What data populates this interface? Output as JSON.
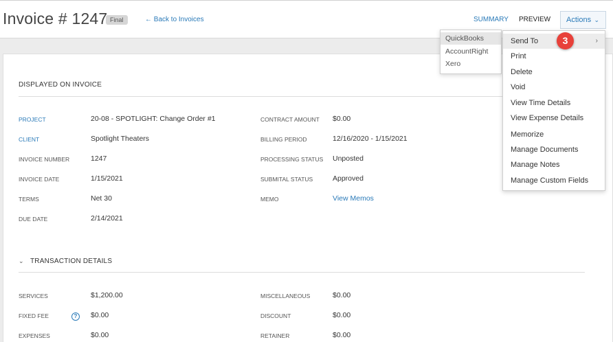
{
  "header": {
    "title": "Invoice # 1247",
    "status_badge": "Final",
    "back_link": "← Back to Invoices",
    "tabs": [
      {
        "label": "SUMMARY"
      },
      {
        "label": "PREVIEW"
      }
    ],
    "actions_label": "Actions",
    "actions_chevron": "⌄"
  },
  "displayed_section": {
    "title": "DISPLAYED ON INVOICE",
    "left_fields": [
      {
        "label": "PROJECT",
        "value": "20-08 - SPOTLIGHT: Change Order #1"
      },
      {
        "label": "CLIENT",
        "value": "Spotlight Theaters"
      },
      {
        "label": "INVOICE NUMBER",
        "value": "1247"
      },
      {
        "label": "INVOICE DATE",
        "value": "1/15/2021"
      },
      {
        "label": "TERMS",
        "value": "Net 30"
      },
      {
        "label": "DUE DATE",
        "value": "2/14/2021"
      }
    ],
    "right_fields": [
      {
        "label": "CONTRACT AMOUNT",
        "value": "$0.00"
      },
      {
        "label": "BILLING PERIOD",
        "value": "12/16/2020 - 1/15/2021"
      },
      {
        "label": "PROCESSING STATUS",
        "value": "Unposted"
      },
      {
        "label": "SUBMITAL STATUS",
        "value": "Approved"
      },
      {
        "label": "MEMO",
        "value": "View Memos"
      }
    ]
  },
  "transaction_section": {
    "toggle_icon": "⌄",
    "title": "TRANSACTION DETAILS",
    "left_fields": [
      {
        "label": "SERVICES",
        "value": "$1,200.00"
      },
      {
        "label": "FIXED FEE",
        "value": "$0.00"
      },
      {
        "label": "EXPENSES",
        "value": "$0.00"
      }
    ],
    "right_fields": [
      {
        "label": "MISCELLANEOUS",
        "value": "$0.00"
      },
      {
        "label": "DISCOUNT",
        "value": "$0.00"
      },
      {
        "label": "RETAINER",
        "value": "$0.00"
      }
    ],
    "help_icon": "?"
  },
  "actions_menu": {
    "items": [
      {
        "label": "Send To",
        "arrow": "›"
      },
      {
        "label": "Print"
      },
      {
        "label": "Delete"
      },
      {
        "label": "Void"
      },
      {
        "label": "View Time Details"
      },
      {
        "label": "View Expense Details"
      },
      {
        "label": "Memorize"
      },
      {
        "label": "Manage Documents"
      },
      {
        "label": "Manage Notes"
      },
      {
        "label": "Manage Custom Fields"
      }
    ]
  },
  "send_to_submenu": {
    "items": [
      {
        "label": "QuickBooks"
      },
      {
        "label": "AccountRight"
      },
      {
        "label": "Xero"
      }
    ]
  },
  "step_badge": "3",
  "colors": {
    "accent": "#2a7ab8",
    "badge_red": "#e8413a",
    "page_bg": "#ececec"
  }
}
